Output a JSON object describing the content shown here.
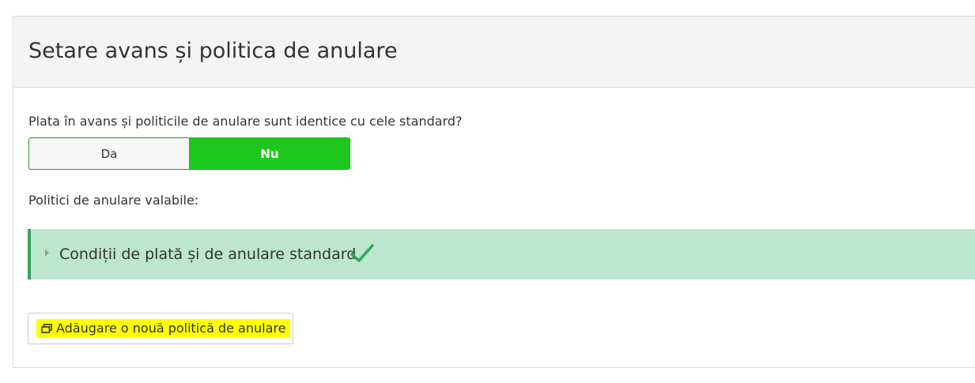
{
  "panel": {
    "title": "Setare avans și politica de anulare"
  },
  "advance": {
    "question": "Plata în avans și politicile de anulare sunt identice cu cele standard?",
    "options": [
      {
        "label": "Da",
        "selected": false
      },
      {
        "label": "Nu",
        "selected": true
      }
    ]
  },
  "policies": {
    "label": "Politici de anulare valabile:",
    "items": [
      {
        "label": "Condiții de plată și de anulare standard",
        "status_icon": "checkmark-icon",
        "expand_icon": "caret-right-icon"
      }
    ]
  },
  "add_button": {
    "label": "Adăugare o nouă politică de anulare",
    "icon": "window-restore-icon"
  },
  "colors": {
    "selected_toggle": "#1ec71e",
    "policy_background": "#bde6cf",
    "policy_border": "#34a45c",
    "checkmark": "#2ea85a",
    "highlight": "#ffff00"
  }
}
